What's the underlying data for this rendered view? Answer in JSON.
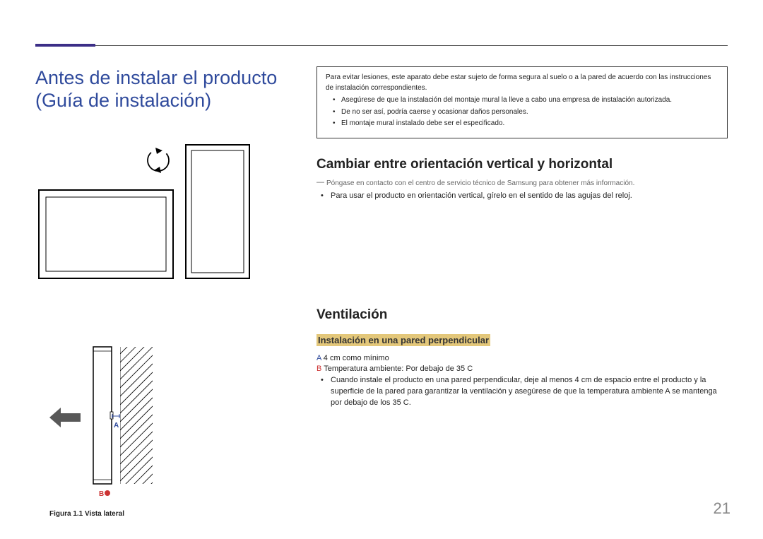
{
  "main_title": "Antes de instalar el producto (Guía de instalación)",
  "warning": {
    "lead": "Para evitar lesiones, este aparato debe estar sujeto de forma segura al suelo o a la pared de acuerdo con las instrucciones de instalación correspondientes.",
    "bullets": [
      "Asegúrese de que la instalación del montaje mural la lleve a cabo una empresa de instalación autorizada.",
      "De no ser así, podría caerse y ocasionar daños personales.",
      "El montaje mural instalado debe ser el especificado."
    ]
  },
  "section_orientation": {
    "heading": "Cambiar entre orientación vertical y horizontal",
    "note": "Póngase en contacto con el centro de servicio técnico de Samsung para obtener más información.",
    "bullets": [
      "Para usar el producto en orientación vertical, gírelo en el sentido de las agujas del reloj."
    ]
  },
  "section_ventilation": {
    "heading": "Ventilación",
    "sub_heading": "Instalación en una pared perpendicular",
    "spec_a_label": "A",
    "spec_a_text": " 4 cm como mínimo",
    "spec_b_label": "B",
    "spec_b_text": " Temperatura ambiente: Por debajo de 35 C",
    "bullets": [
      "Cuando instale el producto en una pared perpendicular, deje al menos 4 cm de espacio entre el producto y la superficie de la pared para garantizar la ventilación y asegúrese de que la temperatura ambiente A se mantenga por debajo de los 35 C."
    ]
  },
  "figure_side": {
    "label_a": "A",
    "label_b": "B",
    "caption": "Figura 1.1 Vista lateral"
  },
  "page_number": "21"
}
